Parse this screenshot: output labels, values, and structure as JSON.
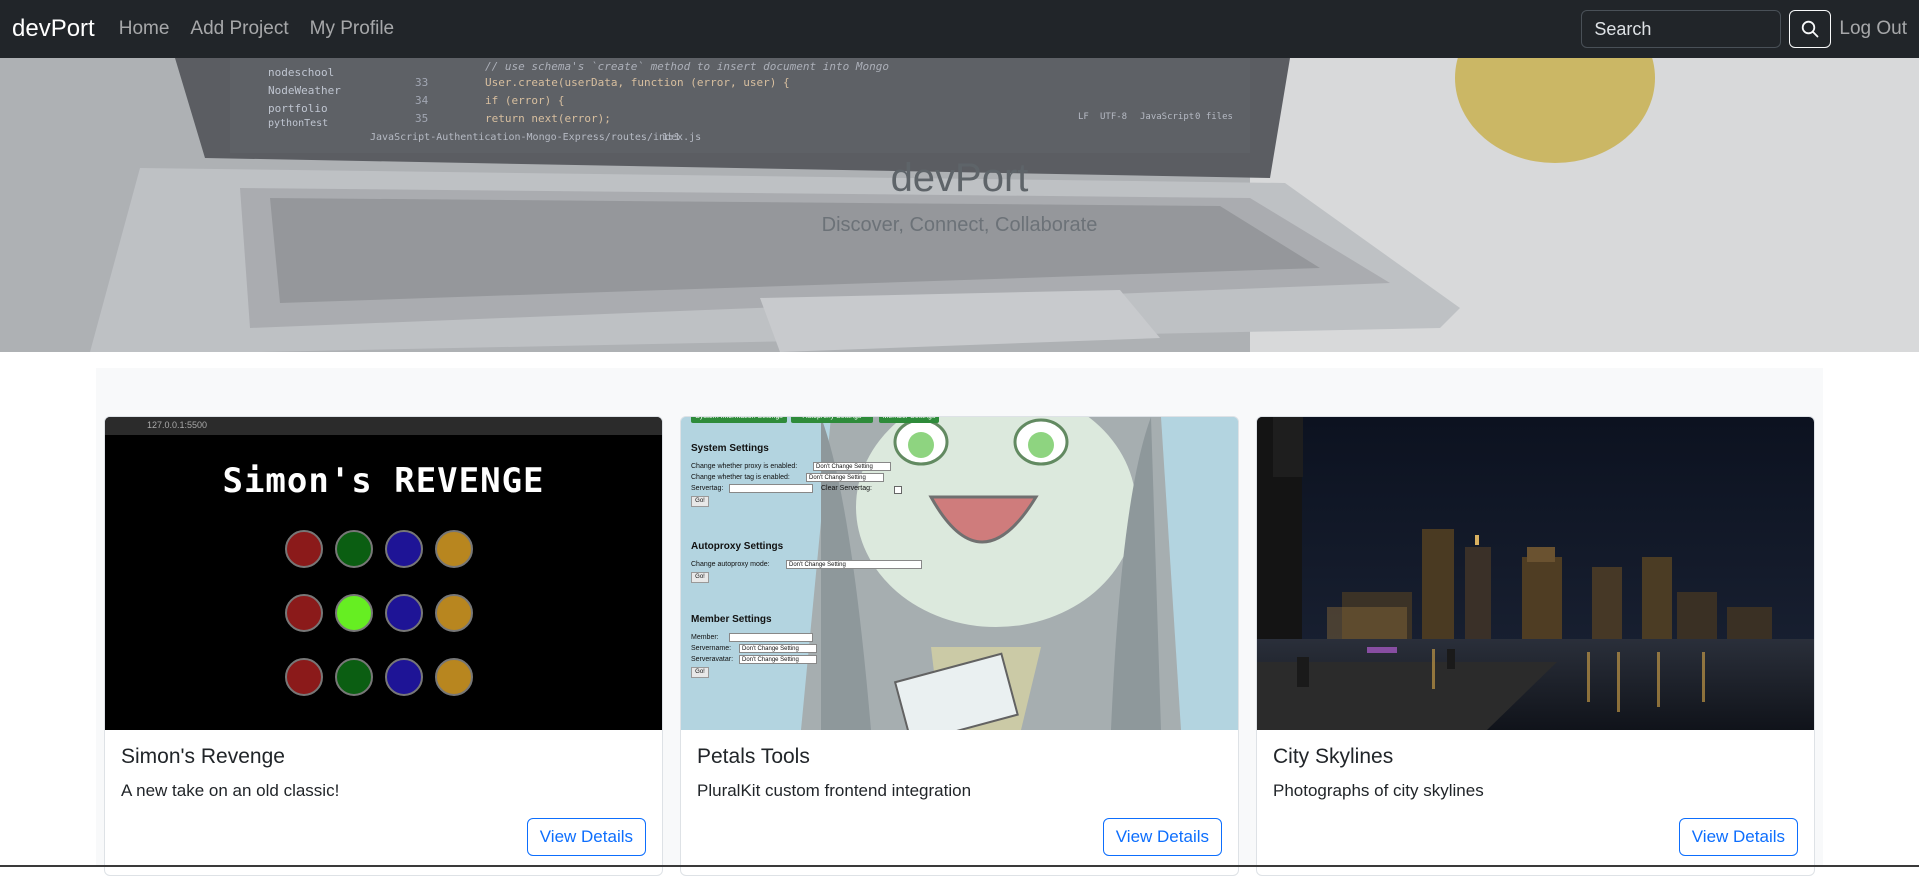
{
  "nav": {
    "brand": "devPort",
    "links": [
      "Home",
      "Add Project",
      "My Profile"
    ],
    "search_placeholder": "Search",
    "search_icon": "search-icon",
    "logout": "Log Out"
  },
  "hero": {
    "title": "devPort",
    "subtitle": "Discover, Connect, Collaborate",
    "code_lines": [
      "// use schema's `create` method to insert document into Mongo",
      "User.create(userData, function (error, user) {",
      "  if (error) {",
      "    return next(error);"
    ],
    "line_numbers": [
      "33",
      "34",
      "35"
    ],
    "tree_items": [
      "nodeschool",
      "NodeWeather",
      "portfolio",
      "pythonTest"
    ],
    "status_left": "JavaScript-Authentication-Mongo-Express/routes/index.js",
    "status_pos": "1:1",
    "status_right": [
      "LF",
      "UTF-8",
      "JavaScript",
      "0 files"
    ]
  },
  "cards": [
    {
      "title": "Simon's Revenge",
      "text": "A new take on an old classic!",
      "button": "View Details",
      "image": {
        "game_title": "Simon's REVENGE",
        "address": "127.0.0.1:5500",
        "colors": [
          "#8b1a1a",
          "#0b5e12",
          "#1e1496",
          "#b8861f"
        ],
        "highlight": "#66ee22"
      }
    },
    {
      "title": "Petals Tools",
      "text": "PluralKit custom frontend integration",
      "button": "View Details",
      "image": {
        "sections": [
          {
            "heading": "System Settings",
            "rows": [
              "Change whether proxy is enabled:",
              "Change whether tag is enabled:",
              "Servertag:"
            ],
            "extra": "Clear Servertag:"
          },
          {
            "heading": "Autoproxy Settings",
            "rows": [
              "Change autoproxy mode:"
            ]
          },
          {
            "heading": "Member Settings",
            "rows": [
              "Member:",
              "Servername:",
              "Serveravatar:"
            ]
          }
        ],
        "select_label": "Don't Change Setting",
        "go": "Go!",
        "top_buttons": [
          "System Information Settings",
          "Autoproxy Settings",
          "Member Settings"
        ]
      }
    },
    {
      "title": "City Skylines",
      "text": "Photographs of city skylines",
      "button": "View Details"
    }
  ]
}
